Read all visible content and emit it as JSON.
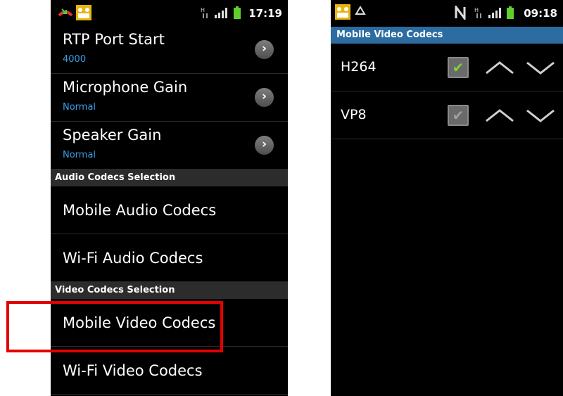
{
  "left_screen": {
    "status": {
      "time": "17:19"
    },
    "prefs": [
      {
        "title": "RTP Port Start",
        "summary": "4000"
      },
      {
        "title": "Microphone Gain",
        "summary": "Normal"
      },
      {
        "title": "Speaker Gain",
        "summary": "Normal"
      }
    ],
    "audio_section": "Audio Codecs Selection",
    "audio_items": [
      "Mobile Audio Codecs",
      "Wi-Fi Audio Codecs"
    ],
    "video_section": "Video Codecs Selection",
    "video_items": [
      "Mobile Video Codecs",
      "Wi-Fi Video Codecs"
    ]
  },
  "right_screen": {
    "status": {
      "time": "09:18"
    },
    "title": "Mobile Video Codecs",
    "codecs": [
      {
        "name": "H264",
        "enabled": true,
        "check_color": "#7cd33a"
      },
      {
        "name": "VP8",
        "enabled": true,
        "check_color": "#9a9a9a"
      }
    ]
  },
  "highlight_color": "#e30000"
}
